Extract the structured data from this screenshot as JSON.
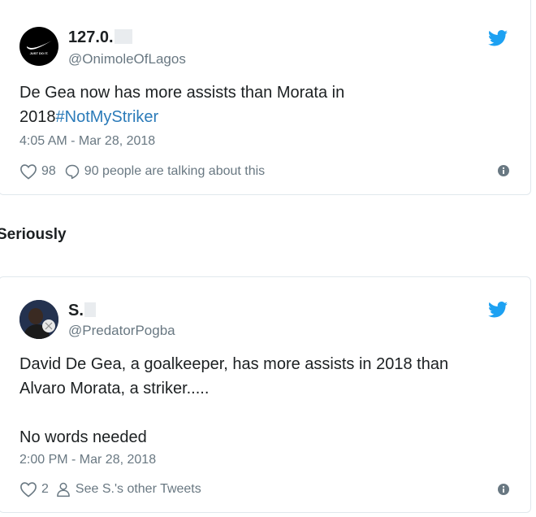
{
  "tweet1": {
    "display_name": "127.0.",
    "handle": "@OnimoleOfLagos",
    "avatar_label": "JUST DO IT.",
    "text_before_hashtag": "De Gea now has more assists than Morata in 2018",
    "hashtag": "#NotMyStriker",
    "timestamp": "4:05 AM - Mar 28, 2018",
    "likes": "98",
    "conversation": "90 people are talking about this"
  },
  "caption": "Seriously",
  "tweet2": {
    "display_name": "S.",
    "handle": "@PredatorPogba",
    "text_line1": "David De Gea, a goalkeeper, has more assists in 2018 than",
    "text_line2": "Alvaro Morata, a striker.....",
    "text_line3": "No words needed",
    "timestamp": "2:00 PM - Mar 28, 2018",
    "likes": "2",
    "profile_link": "See S.'s other Tweets"
  },
  "colors": {
    "twitter_blue": "#1da1f2",
    "hashtag": "#2b7bb9",
    "muted": "#697882",
    "border": "#e1e8ed"
  }
}
